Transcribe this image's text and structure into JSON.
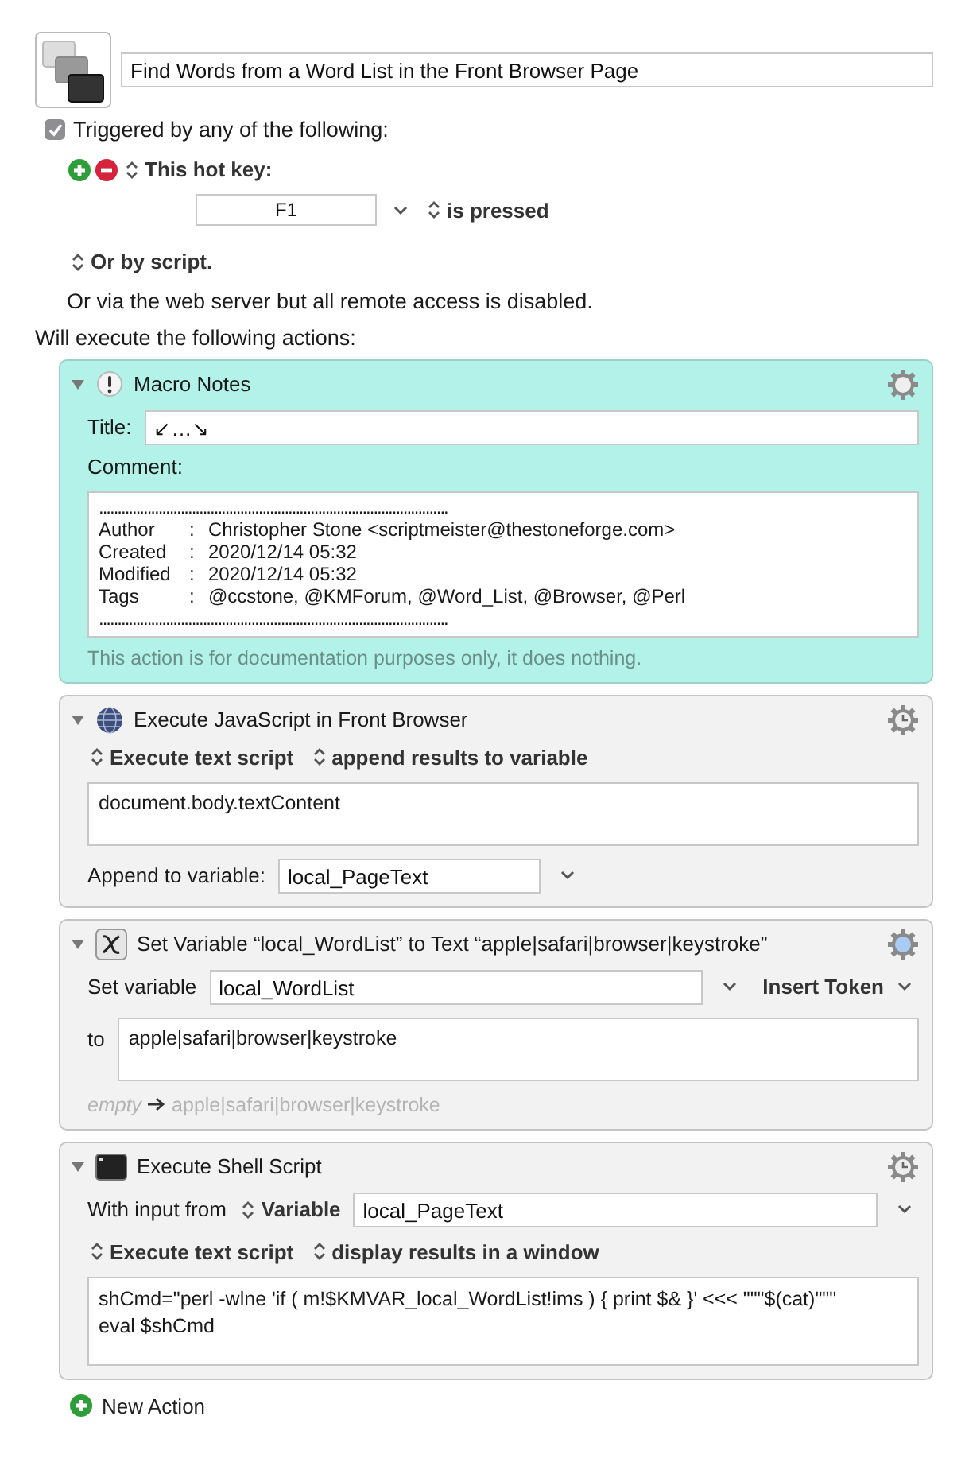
{
  "macro": {
    "name": "Find Words from a Word List in the Front Browser Page"
  },
  "trigger_group": {
    "checked": true,
    "label": "Triggered by any of the following:"
  },
  "hot_key": {
    "popup": "This hot key:",
    "key": "F1",
    "condition": "is pressed"
  },
  "script_trigger": "Or by script.",
  "web_server_note": "Or via the web server but all remote access is disabled.",
  "actions_heading": "Will execute the following actions:",
  "actions": [
    {
      "kind": "notes",
      "expanded": true,
      "title": "Macro Notes",
      "title_label": "Title:",
      "title_value": "↙…↘",
      "comment_label": "Comment:",
      "rule": "..............................................................................................",
      "rows": [
        {
          "label": "Author",
          "sep": ":",
          "value": "Christopher Stone <scriptmeister@thestoneforge.com>"
        },
        {
          "label": "Created",
          "sep": ":",
          "value": "2020/12/14 05:32"
        },
        {
          "label": "Modified",
          "sep": ":",
          "value": "2020/12/14 05:32"
        },
        {
          "label": "Tags",
          "sep": ":",
          "value": "@ccstone, @KMForum, @Word_List, @Browser, @Perl"
        }
      ],
      "footer": "This action is for documentation purposes only, it does nothing."
    },
    {
      "kind": "javascript",
      "expanded": true,
      "title": "Execute JavaScript in Front Browser",
      "options": [
        "Execute text script",
        "append results to variable"
      ],
      "script": [
        "document.body.textContent"
      ],
      "variable_label": "Append to variable:",
      "variable": "local_PageText"
    },
    {
      "kind": "set_variable",
      "expanded": true,
      "title": "Set Variable “local_WordList” to Text “apple|safari|browser|keystroke”",
      "variable_label": "Set variable",
      "variable": "local_WordList",
      "insert_token": "Insert Token",
      "to_label": "to",
      "value": "apple|safari|browser|keystroke",
      "preview_empty": "empty",
      "preview": "apple|safari|browser|keystroke"
    },
    {
      "kind": "shell",
      "expanded": true,
      "title": "Execute Shell Script",
      "input_label": "With input from",
      "input_source": "Variable",
      "variable": "local_PageText",
      "options": [
        "Execute text script",
        "display results in a window"
      ],
      "script": [
        "shCmd=\"perl -wlne 'if ( m!$KMVAR_local_WordList!ims ) { print $& }' <<< \"\"\"$(cat)\"\"\"",
        "eval $shCmd"
      ]
    }
  ],
  "new_action": "New Action"
}
